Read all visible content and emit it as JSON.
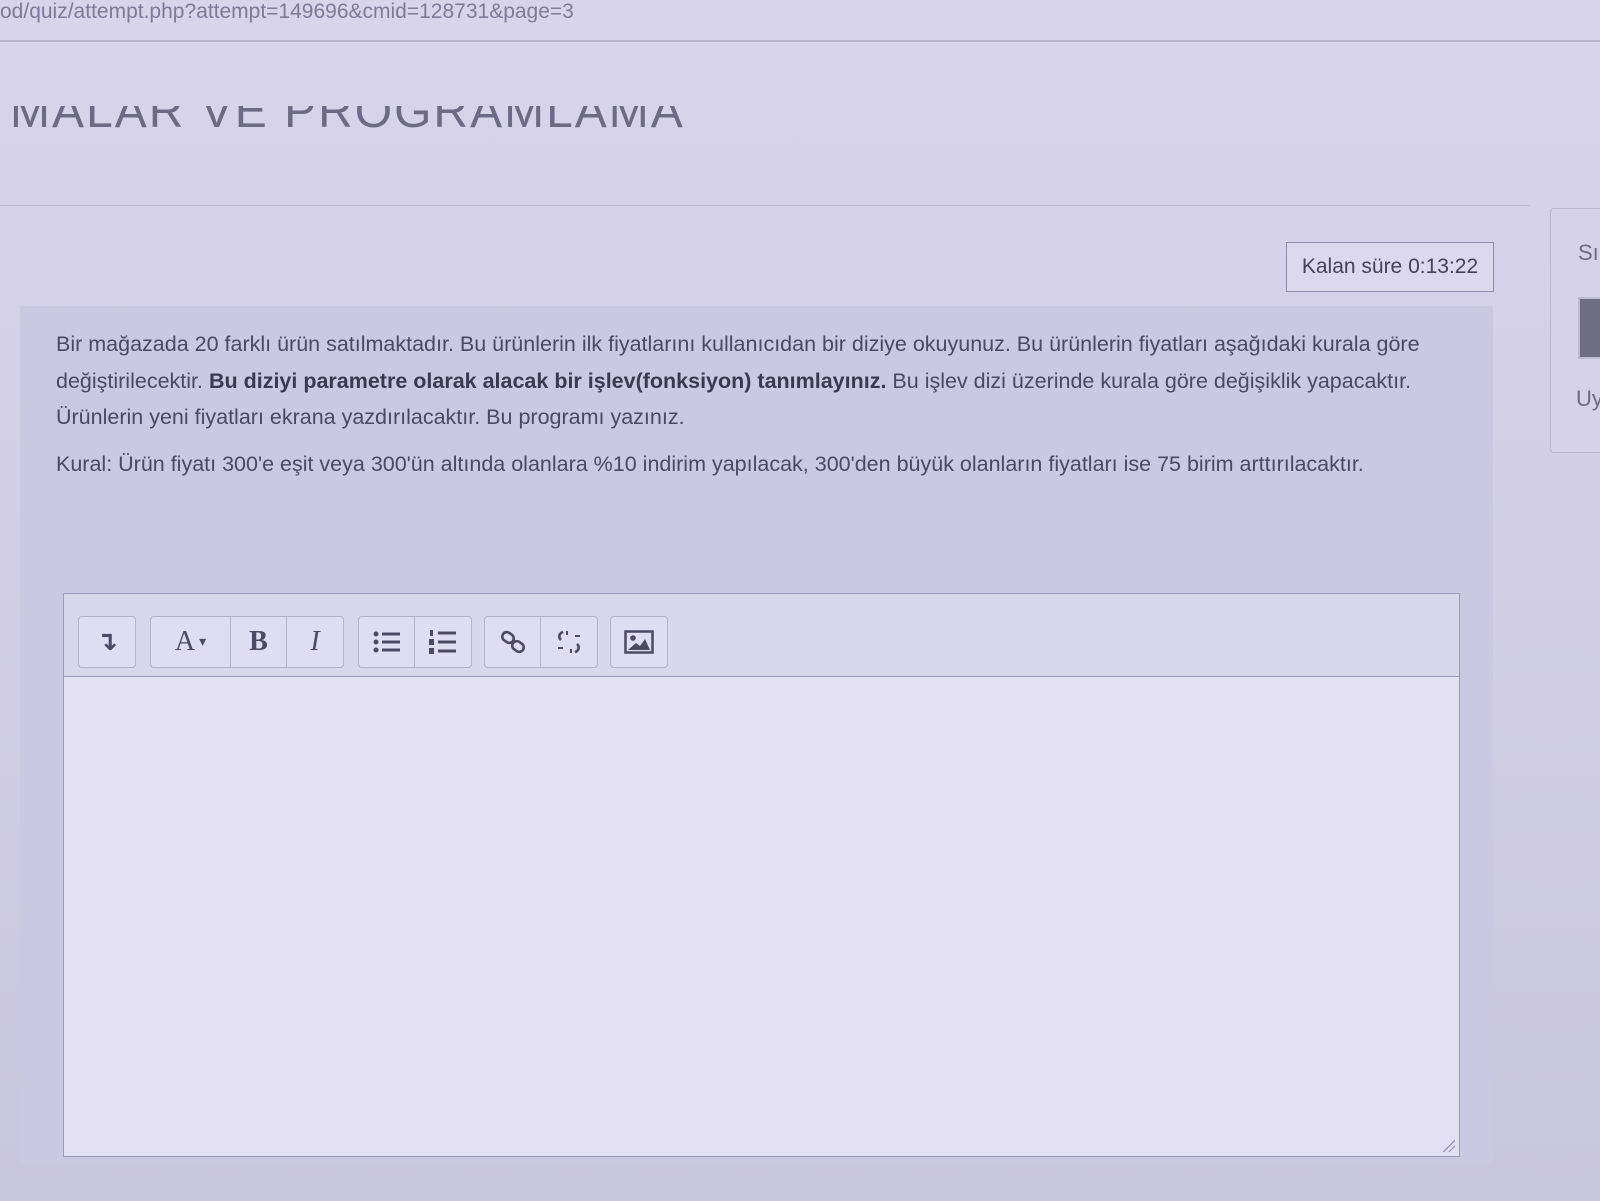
{
  "browser": {
    "url": "od/quiz/attempt.php?attempt=149696&cmid=128731&page=3"
  },
  "page": {
    "course_title": "MALAR VE PROGRAMLAMA"
  },
  "timer": {
    "label": "Kalan süre 0:13:22"
  },
  "question": {
    "p1_start": "Bir mağazada 20 farklı ürün satılmaktadır. Bu ürünlerin ilk fiyatlarını kullanıcıdan bir diziye okuyunuz. Bu ürünlerin fiyatları aşağıdaki kurala göre değiştirilecektir. ",
    "p1_bold": "Bu diziyi parametre olarak alacak bir işlev(fonksiyon) tanımlayınız.",
    "p1_end": " Bu işlev dizi üzerinde kurala göre değişiklik yapacaktır. Ürünlerin yeni fiyatları ekrana yazdırılacaktır. Bu programı yazınız.",
    "p2": "Kural: Ürün fiyatı 300'e eşit veya 300'ün altında olanlara %10 indirim yapılacak, 300'den büyük olanların fiyatları ise 75 birim arttırılacaktır."
  },
  "editor": {
    "toolbar": {
      "toggle_icon": "↴",
      "font_label": "A",
      "bold_label": "B",
      "italic_label": "I"
    },
    "value": ""
  },
  "side_panel": {
    "s_text": "Sı",
    "u_text": "Uy"
  },
  "colors": {
    "background": "#d6d2ea",
    "question_box": "#cbc8e4",
    "editor_bg": "#e2e0f2"
  }
}
